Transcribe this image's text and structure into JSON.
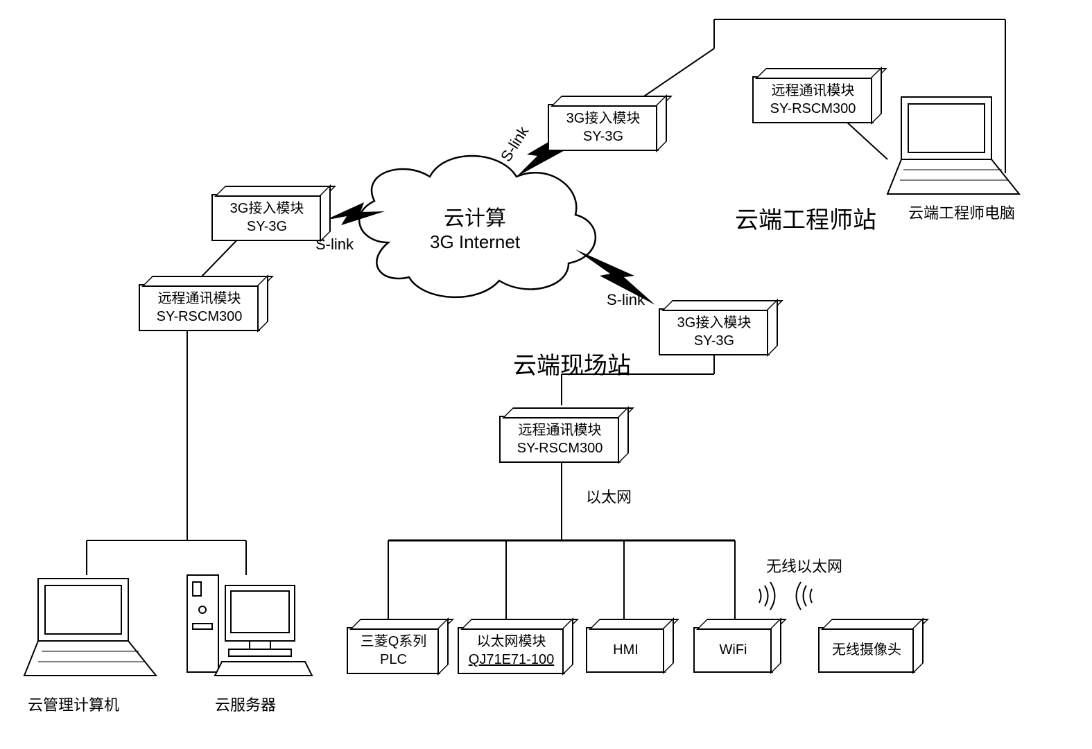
{
  "cloud": {
    "line1": "云计算",
    "line2": "3G Internet"
  },
  "links": {
    "slink1": "S-link",
    "slink2": "S-link",
    "slink3": "S-link"
  },
  "sections": {
    "engineer": "云端工程师站",
    "field": "云端现场站",
    "engineerPC": "云端工程师电脑",
    "mgmtPC": "云管理计算机",
    "server": "云服务器",
    "ethernet": "以太网",
    "wirelessEth": "无线以太网"
  },
  "modules": {
    "m3g_left": {
      "l1": "3G接入模块",
      "l2": "SY-3G"
    },
    "m3g_top": {
      "l1": "3G接入模块",
      "l2": "SY-3G"
    },
    "m3g_right": {
      "l1": "3G接入模块",
      "l2": "SY-3G"
    },
    "rscm_left": {
      "l1": "远程通讯模块",
      "l2": "SY-RSCM300"
    },
    "rscm_top": {
      "l1": "远程通讯模块",
      "l2": "SY-RSCM300"
    },
    "rscm_field": {
      "l1": "远程通讯模块",
      "l2": "SY-RSCM300"
    }
  },
  "devices": {
    "plc": {
      "l1": "三菱Q系列",
      "l2": "PLC"
    },
    "ethmod": {
      "l1": "以太网模块",
      "l2": "QJ71E71-100"
    },
    "hmi": {
      "l1": "HMI"
    },
    "wifi": {
      "l1": "WiFi"
    },
    "cam": {
      "l1": "无线摄像头"
    }
  }
}
